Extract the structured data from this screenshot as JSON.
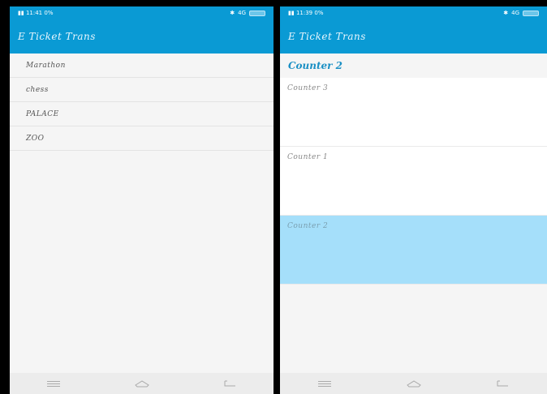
{
  "left": {
    "status": {
      "time": "11:41",
      "extra": "0%",
      "net": "4G"
    },
    "app_title": "E Ticket Trans",
    "items": [
      "Marathon",
      "chess",
      "PALACE",
      "ZOO"
    ]
  },
  "right": {
    "status": {
      "time": "11:39",
      "extra": "0%",
      "net": "4G"
    },
    "app_title": "E Ticket Trans",
    "selected_header": "Counter 2",
    "counters": [
      {
        "label": "Counter 3",
        "selected": false
      },
      {
        "label": "Counter 1",
        "selected": false
      },
      {
        "label": "Counter 2",
        "selected": true
      }
    ]
  },
  "colors": {
    "primary": "#0a9ad4",
    "selected": "#a5dffa",
    "header_text": "#1a8fc4"
  },
  "icons": {
    "menu": "menu-icon",
    "home": "home-icon",
    "back": "back-icon"
  }
}
